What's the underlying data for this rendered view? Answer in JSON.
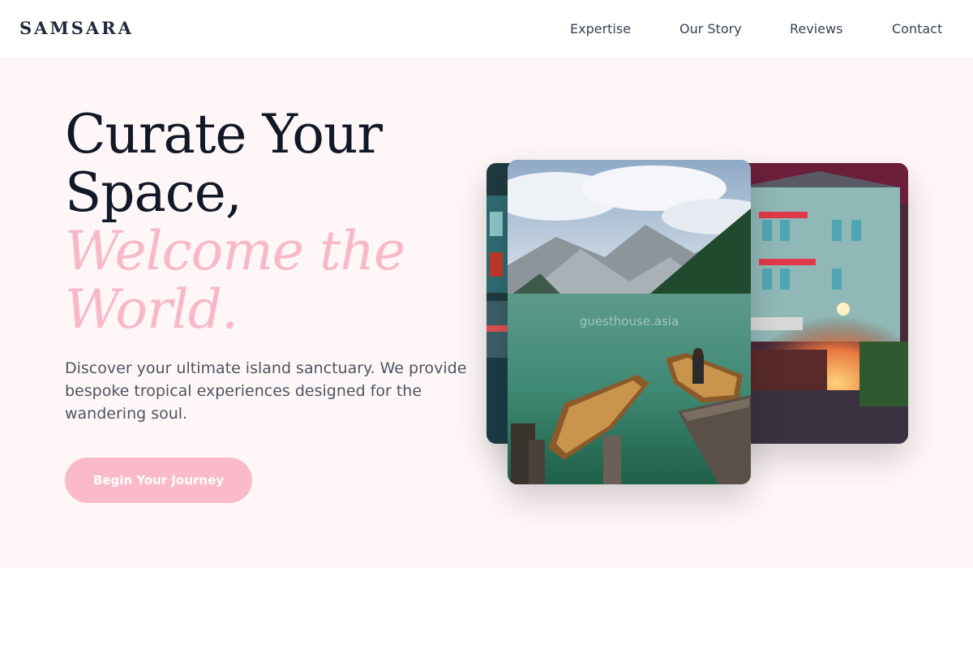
{
  "brand": "SAMSARA",
  "nav": {
    "items": [
      "Expertise",
      "Our Story",
      "Reviews",
      "Contact"
    ]
  },
  "hero": {
    "headline_line1": "Curate Your",
    "headline_line2": "Space,",
    "accent_line1": "Welcome the",
    "accent_line2": "World.",
    "description": "Discover your ultimate island sanctuary. We provide bespoke tropical experiences designed for the wandering soul.",
    "cta_label": "Begin Your Journey"
  },
  "gallery": {
    "watermark": "guesthouse.asia",
    "images": [
      "lake-boats-photo",
      "townhouse-evening-photo",
      "canal-buildings-photo"
    ]
  },
  "colors": {
    "accent_pink": "#f9b8c8",
    "button_pink": "#fbbac9",
    "hero_background": "#fff7f7",
    "headline_dark": "#111827"
  }
}
